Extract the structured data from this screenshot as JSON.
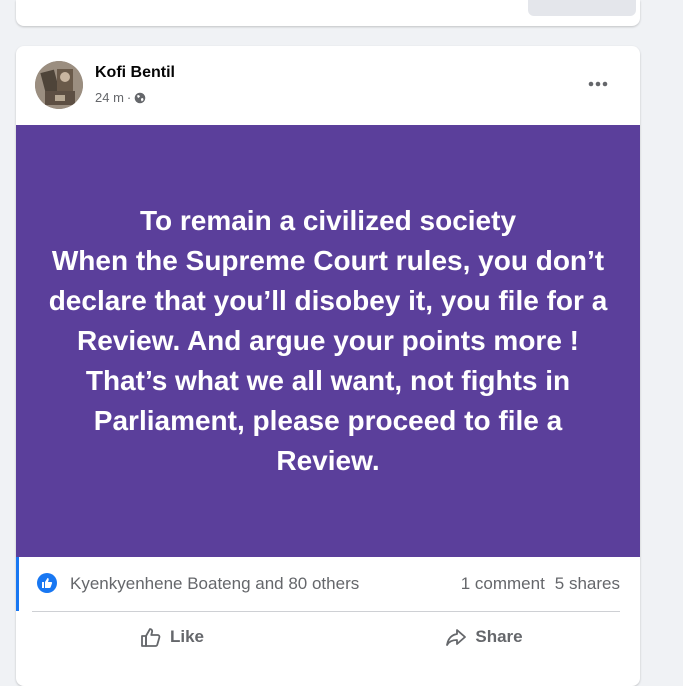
{
  "post": {
    "author": "Kofi Bentil",
    "time": "24 m",
    "separator": "·",
    "body": "To remain a civilized society\nWhen the Supreme Court rules, you don’t declare that you’ll disobey it, you file for a Review. And argue your points more ! That’s what we all want, not fights in Parliament, please proceed to file a Review.",
    "background_color": "#5b3f9b",
    "text_color": "#ffffff",
    "icons": {
      "privacy": "globe-icon",
      "more": "more-options-icon",
      "reaction": "like-reaction-icon"
    }
  },
  "reactions": {
    "reactors": "Kyenkyenhene Boateng and 80 others",
    "comments": "1 comment",
    "shares": "5 shares"
  },
  "actions": {
    "like_label": "Like",
    "share_label": "Share"
  },
  "colors": {
    "accent": "#1877f2",
    "secondary_text": "#65676b",
    "page_background": "#f0f2f5"
  }
}
